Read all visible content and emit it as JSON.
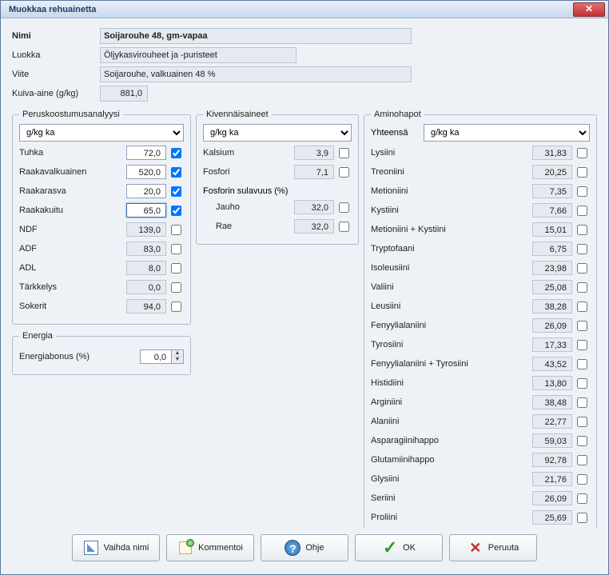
{
  "window": {
    "title": "Muokkaa rehuainetta"
  },
  "top": {
    "nimi_label": "Nimi",
    "nimi_value": "Soijarouhe 48, gm-vapaa",
    "luokka_label": "Luokka",
    "luokka_value": "Öljykasvirouheet ja -puristeet",
    "viite_label": "Viite",
    "viite_value": "Soijarouhe, valkuainen 48 %",
    "kuiva_label": "Kuiva-aine (g/kg)",
    "kuiva_value": "881,0"
  },
  "perus": {
    "legend": "Peruskoostumusanalyysi",
    "unit": "g/kg ka",
    "rows": [
      {
        "label": "Tuhka",
        "value": "72,0",
        "editable": true,
        "checked": true
      },
      {
        "label": "Raakavalkuainen",
        "value": "520,0",
        "editable": true,
        "checked": true
      },
      {
        "label": "Raakarasva",
        "value": "20,0",
        "editable": true,
        "checked": true
      },
      {
        "label": "Raakakuitu",
        "value": "65,0",
        "editable": true,
        "checked": true,
        "active": true
      },
      {
        "label": "NDF",
        "value": "139,0",
        "editable": false,
        "checked": false
      },
      {
        "label": "ADF",
        "value": "83,0",
        "editable": false,
        "checked": false
      },
      {
        "label": "ADL",
        "value": "8,0",
        "editable": false,
        "checked": false
      },
      {
        "label": "Tärkkelys",
        "value": "0,0",
        "editable": false,
        "checked": false
      },
      {
        "label": "Sokerit",
        "value": "94,0",
        "editable": false,
        "checked": false
      }
    ]
  },
  "energia": {
    "legend": "Energia",
    "bonus_label": "Energiabonus (%)",
    "bonus_value": "0,0"
  },
  "kiven": {
    "legend": "Kivennäisaineet",
    "unit": "g/kg ka",
    "rows": [
      {
        "label": "Kalsium",
        "value": "3,9"
      },
      {
        "label": "Fosfori",
        "value": "7,1"
      }
    ],
    "fosf_legend": "Fosforin sulavuus (%)",
    "fosf_rows": [
      {
        "label": "Jauho",
        "value": "32,0"
      },
      {
        "label": "Rae",
        "value": "32,0"
      }
    ]
  },
  "amino": {
    "legend": "Aminohapot",
    "yhteensa_label": "Yhteensä",
    "unit": "g/kg ka",
    "rows": [
      {
        "label": "Lysiini",
        "value": "31,83"
      },
      {
        "label": "Treoniini",
        "value": "20,25"
      },
      {
        "label": "Metioniini",
        "value": "7,35"
      },
      {
        "label": "Kystiini",
        "value": "7,66"
      },
      {
        "label": "Metioniini + Kystiini",
        "value": "15,01"
      },
      {
        "label": "Tryptofaani",
        "value": "6,75"
      },
      {
        "label": "Isoleusiini",
        "value": "23,98"
      },
      {
        "label": "Valiini",
        "value": "25,08"
      },
      {
        "label": "Leusiini",
        "value": "38,28"
      },
      {
        "label": "Fenyylialaniini",
        "value": "26,09"
      },
      {
        "label": "Tyrosiini",
        "value": "17,33"
      },
      {
        "label": "Fenyylialaniini + Tyrosiini",
        "value": "43,52"
      },
      {
        "label": "Histidiini",
        "value": "13,80"
      },
      {
        "label": "Arginiini",
        "value": "38,48"
      },
      {
        "label": "Alaniini",
        "value": "22,77"
      },
      {
        "label": "Asparagiinihappo",
        "value": "59,03"
      },
      {
        "label": "Glutamiinihappo",
        "value": "92,78"
      },
      {
        "label": "Glysiini",
        "value": "21,76"
      },
      {
        "label": "Seriini",
        "value": "26,09"
      },
      {
        "label": "Proliini",
        "value": "25,69"
      }
    ]
  },
  "buttons": {
    "vaihda": "Vaihda nimi",
    "kommentoi": "Kommentoi",
    "ohje": "Ohje",
    "ok": "OK",
    "peruuta": "Peruuta"
  }
}
